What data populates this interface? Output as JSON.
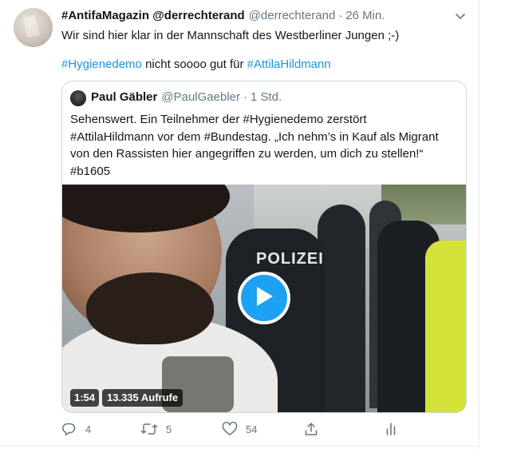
{
  "tweet": {
    "author_name": "#AntifaMagazin @derrechterand",
    "author_handle": "@derrechterand",
    "separator": "·",
    "time": "26 Min.",
    "line1": "Wir sind hier klar in der Mannschaft des Westberliner Jungen ;-)",
    "line2_tag1": "#Hygienedemo",
    "line2_middle": " nicht soooo gut für ",
    "line2_tag2": "#AttilaHildmann"
  },
  "quote": {
    "author_name": "Paul Gäbler",
    "author_handle": "@PaulGaebler",
    "separator": "·",
    "time": "1 Std.",
    "lines": [
      "Sehenswert. Ein Teilnehmer der #Hygienedemo zerstört",
      "#AttilaHildmann vor dem #Bundestag. „Ich nehm’s in Kauf als Migrant",
      "von den Rassisten hier angegriffen zu werden, um dich zu stellen!“",
      "#b1605"
    ],
    "video": {
      "police_text": "POLIZEI",
      "duration": "1:54",
      "views": "13.335 Aufrufe"
    }
  },
  "actions": {
    "reply_count": "4",
    "retweet_count": "5",
    "like_count": "54"
  },
  "icons": {
    "reply": "reply-icon",
    "retweet": "retweet-icon",
    "like": "heart-icon",
    "share": "share-icon",
    "analytics": "analytics-icon",
    "caret": "chevron-down-icon",
    "play": "play-icon"
  },
  "colors": {
    "link": "#1b95e0",
    "play_button": "#1da1f2",
    "secondary_text": "#657786"
  }
}
